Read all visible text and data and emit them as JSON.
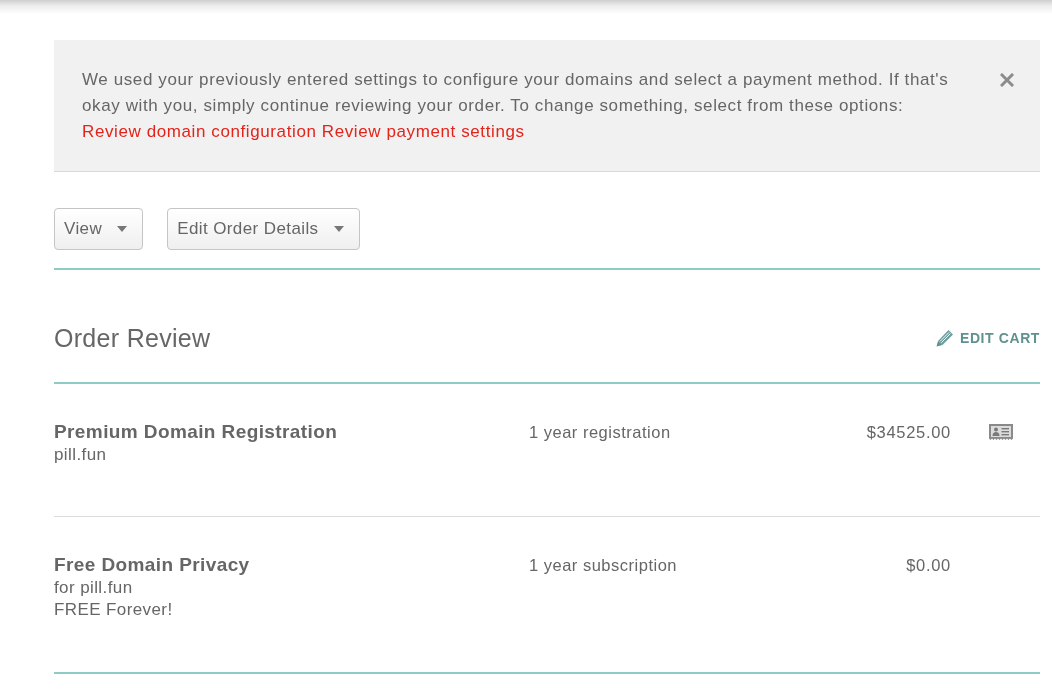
{
  "notice": {
    "message": "We used your previously entered settings to configure your domains and select a payment method. If that's okay with you, simply continue reviewing your order. To change something, select from these options:",
    "links": [
      "Review domain configuration",
      "Review payment settings"
    ]
  },
  "toolbar": {
    "dropdowns": [
      "View",
      "Edit Order Details"
    ]
  },
  "order_review": {
    "title": "Order Review",
    "edit_cart": "EDIT CART",
    "items": [
      {
        "kind": "registration",
        "name": "Premium Domain Registration",
        "details": [
          "pill.fun"
        ],
        "term": "1 year registration",
        "price": "$34525.00"
      },
      {
        "kind": "addon",
        "name": "Free Domain Privacy",
        "details": [
          "for pill.fun",
          "FREE Forever!"
        ],
        "term": "1 year subscription",
        "price": "$0.00"
      }
    ]
  }
}
